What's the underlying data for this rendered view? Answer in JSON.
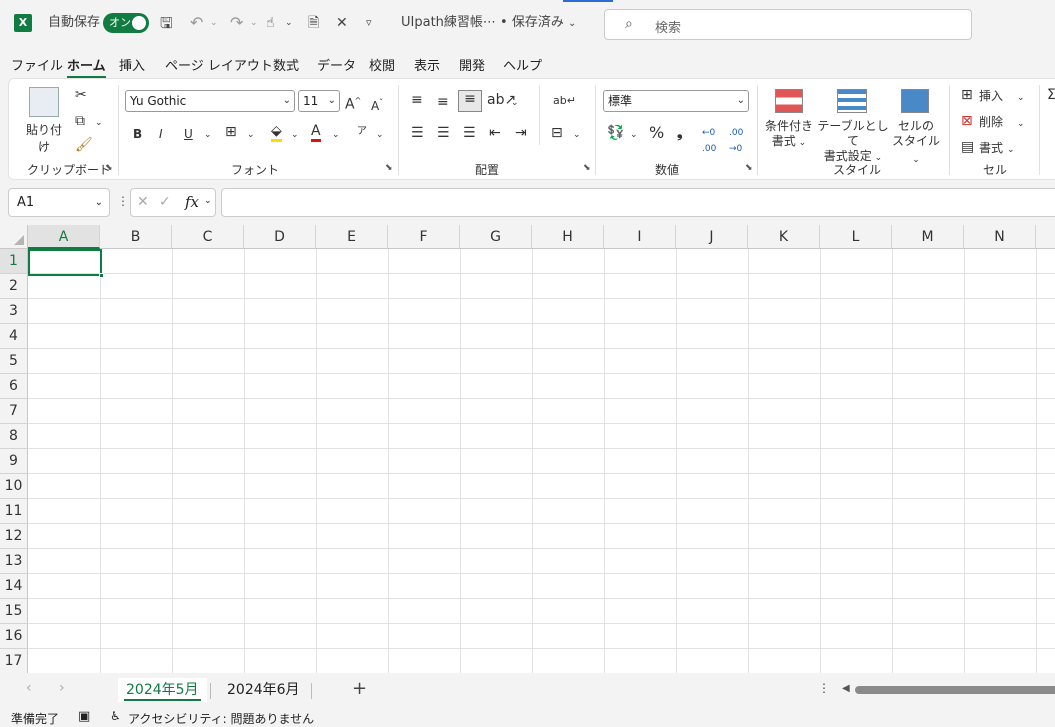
{
  "titlebar": {
    "autosave_label": "自動保存",
    "toggle_label": "オン",
    "doc_title": "UIpath練習帳⋯ • 保存済み",
    "search_placeholder": "検索"
  },
  "menu": [
    "ファイル",
    "ホーム",
    "挿入",
    "ページ レイアウト",
    "数式",
    "データ",
    "校閲",
    "表示",
    "開発",
    "ヘルプ"
  ],
  "menu_active": "ホーム",
  "ribbon": {
    "clipboard": {
      "paste": "貼り付け",
      "label": "クリップボード"
    },
    "font": {
      "family": "Yu Gothic",
      "size": "11",
      "bold": "B",
      "italic": "I",
      "underline": "U",
      "label": "フォント"
    },
    "alignment": {
      "label": "配置"
    },
    "number": {
      "format": "標準",
      "percent": "%",
      "label": "数値"
    },
    "styles": {
      "conditional": [
        "条件付き",
        "書式"
      ],
      "table": [
        "テーブルとして",
        "書式設定"
      ],
      "cell": [
        "セルの",
        "スタイル"
      ],
      "label": "スタイル"
    },
    "cells": {
      "insert": "挿入",
      "delete": "削除",
      "format": "書式",
      "label": "セル"
    }
  },
  "formula_bar": {
    "name_box": "A1",
    "fx": "fx",
    "value": ""
  },
  "grid": {
    "columns": [
      "A",
      "B",
      "C",
      "D",
      "E",
      "F",
      "G",
      "H",
      "I",
      "J",
      "K",
      "L",
      "M",
      "N"
    ],
    "rows": [
      "1",
      "2",
      "3",
      "4",
      "5",
      "6",
      "7",
      "8",
      "9",
      "10",
      "11",
      "12",
      "13",
      "14",
      "15",
      "16",
      "17"
    ],
    "active_cell": "A1"
  },
  "sheets": [
    "2024年5月",
    "2024年6月"
  ],
  "active_sheet": "2024年5月",
  "status": {
    "ready": "準備完了",
    "accessibility": "アクセシビリティ: 問題ありません"
  },
  "colors": {
    "accent": "#107c41"
  }
}
